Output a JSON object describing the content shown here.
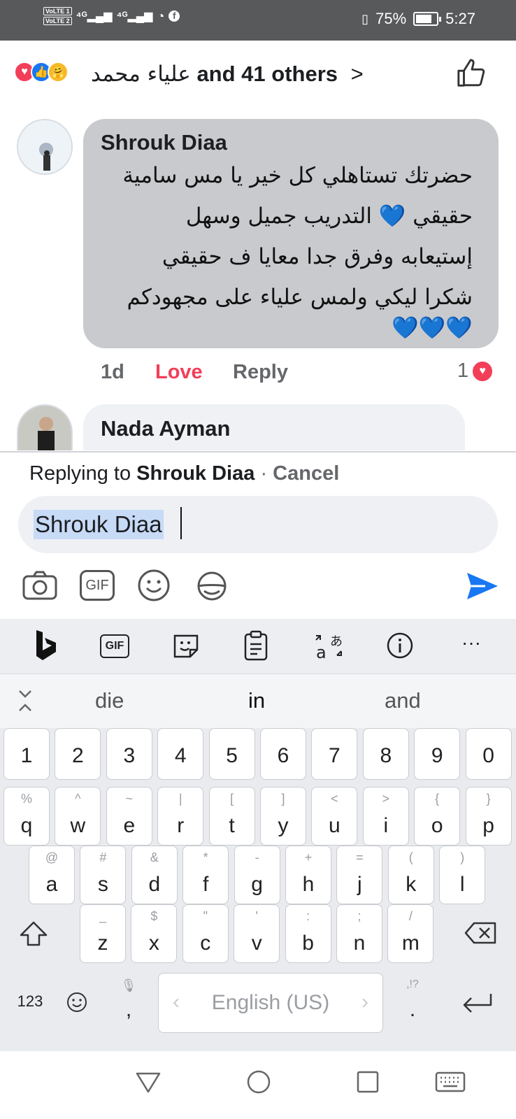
{
  "status_bar": {
    "network_left": "VoLTE 4G 4G",
    "battery_percent": "75%",
    "time": "5:27"
  },
  "reactions": {
    "names": "علياء محمد",
    "others": "and 41 others",
    "arrow": ">"
  },
  "comment1": {
    "author": "Shrouk Diaa",
    "lines": [
      "حضرتك تستاهلي كل خير يا مس سامية",
      "حقيقي 💙 التدريب جميل وسهل",
      "إستيعابه وفرق جدا معايا ف حقيقي",
      "شكرا ليكي ولمس علياء على مجهودكم",
      "💙💙💙"
    ],
    "time": "1d",
    "love_label": "Love",
    "reply_label": "Reply",
    "reaction_count": "1"
  },
  "comment2": {
    "author": "Nada Ayman"
  },
  "reply_bar": {
    "prefix": "Replying to",
    "target": "Shrouk Diaa",
    "separator": "·",
    "cancel": "Cancel",
    "input_value": "Shrouk Diaa",
    "gif_label": "GIF"
  },
  "keyboard": {
    "toolbar_gif": "GIF",
    "toolbar_more": "···",
    "suggestions": [
      "die",
      "in",
      "and"
    ],
    "numbers": [
      "1",
      "2",
      "3",
      "4",
      "5",
      "6",
      "7",
      "8",
      "9",
      "0"
    ],
    "row1": [
      {
        "k": "q",
        "h": "%"
      },
      {
        "k": "w",
        "h": "^"
      },
      {
        "k": "e",
        "h": "~"
      },
      {
        "k": "r",
        "h": "|"
      },
      {
        "k": "t",
        "h": "["
      },
      {
        "k": "y",
        "h": "]"
      },
      {
        "k": "u",
        "h": "<"
      },
      {
        "k": "i",
        "h": ">"
      },
      {
        "k": "o",
        "h": "{"
      },
      {
        "k": "p",
        "h": "}"
      }
    ],
    "row2": [
      {
        "k": "a",
        "h": "@"
      },
      {
        "k": "s",
        "h": "#"
      },
      {
        "k": "d",
        "h": "&"
      },
      {
        "k": "f",
        "h": "*"
      },
      {
        "k": "g",
        "h": "-"
      },
      {
        "k": "h",
        "h": "+"
      },
      {
        "k": "j",
        "h": "="
      },
      {
        "k": "k",
        "h": "("
      },
      {
        "k": "l",
        "h": ")"
      }
    ],
    "row3": [
      {
        "k": "z",
        "h": "_"
      },
      {
        "k": "x",
        "h": "$"
      },
      {
        "k": "c",
        "h": "\""
      },
      {
        "k": "v",
        "h": "'"
      },
      {
        "k": "b",
        "h": ":"
      },
      {
        "k": "n",
        "h": ";"
      },
      {
        "k": "m",
        "h": "/"
      }
    ],
    "num_switch": "123",
    "comma": ",",
    "space_label": "English (US)",
    "period": ".",
    "period_hint": ",!?"
  },
  "colors": {
    "facebook_blue": "#1877f2",
    "love_red": "#f33e58",
    "bubble_gray": "#c9cacd"
  }
}
